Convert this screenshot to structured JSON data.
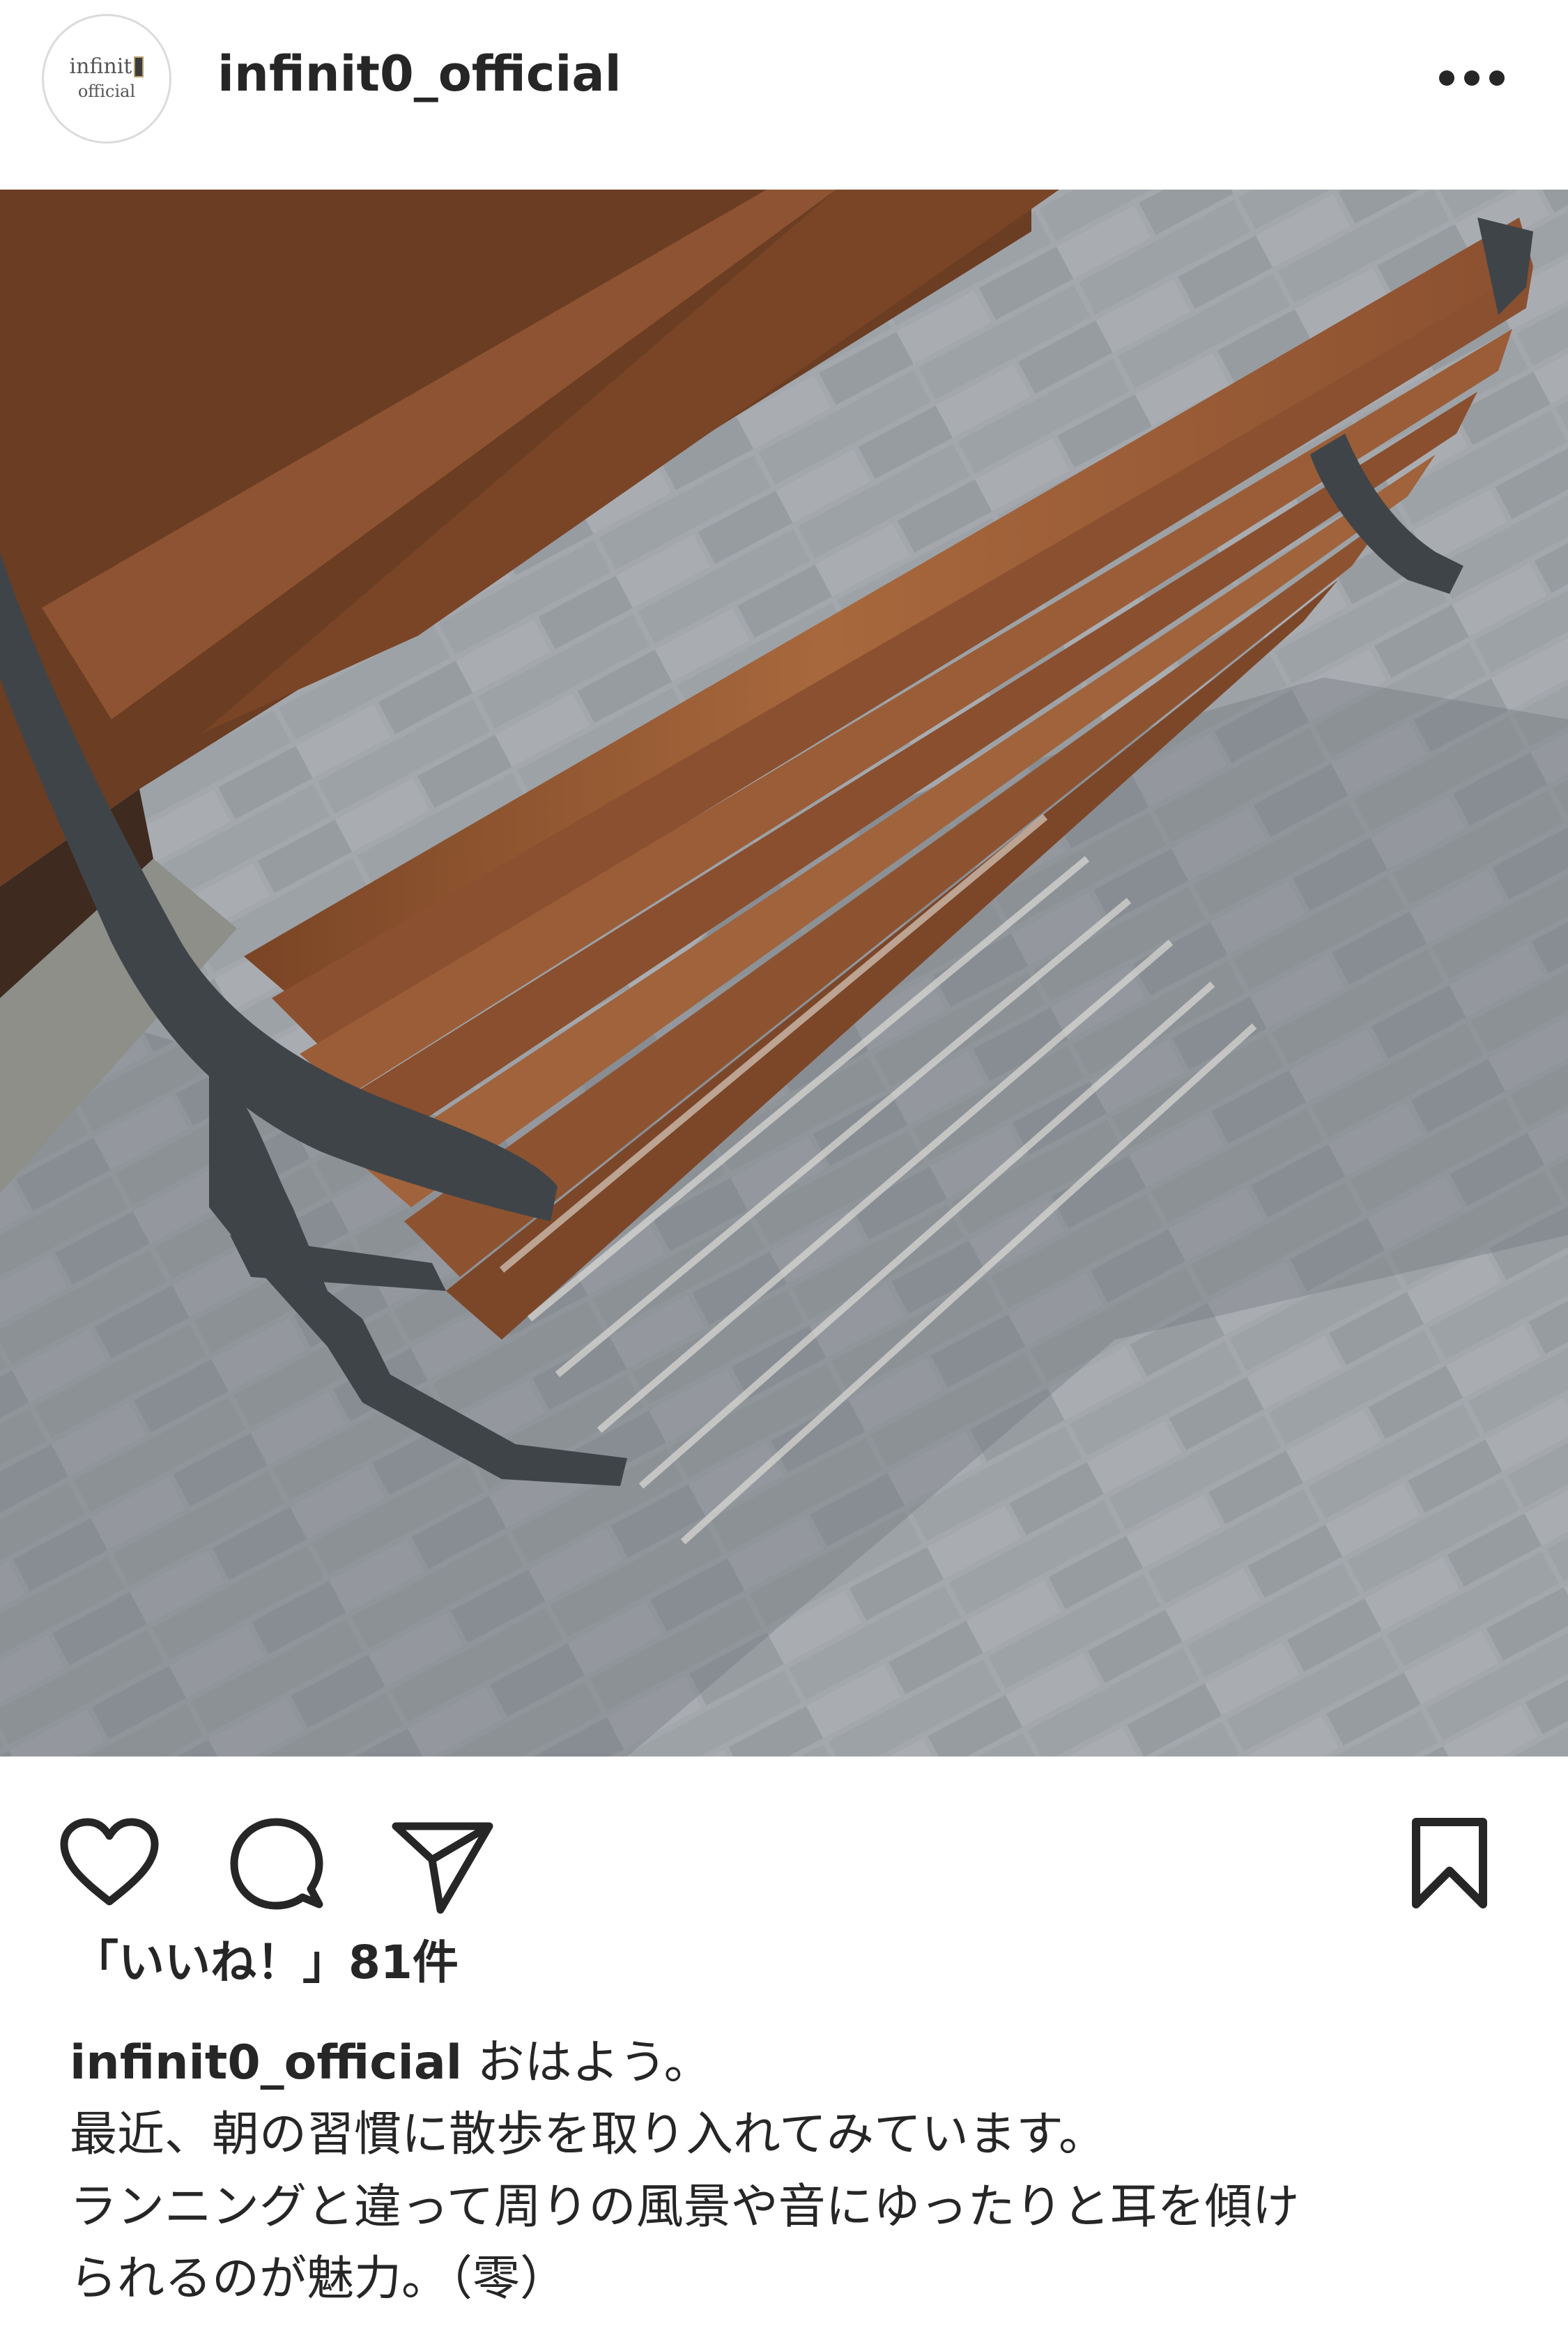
{
  "post": {
    "username": "infinit0_official",
    "avatar": {
      "brand": "infinit",
      "sub": "official"
    },
    "likes_label": "「いいね！」81件",
    "caption": {
      "username": "infinit0_official",
      "first": "おはよう。",
      "line2": "最近、朝の習慣に散歩を取り入れてみています。",
      "line3": "ランニングと違って周りの風景や音にゆったりと耳を傾け",
      "line4": "られるのが魅力。（零）"
    }
  },
  "icons": {
    "more": "more-options-icon",
    "like": "heart-icon",
    "comment": "comment-icon",
    "share": "paper-plane-icon",
    "save": "bookmark-icon"
  },
  "colors": {
    "text": "#262626",
    "border": "#dbdbdb",
    "wood": "#9a5a32",
    "paving": "#9a9ea3"
  }
}
